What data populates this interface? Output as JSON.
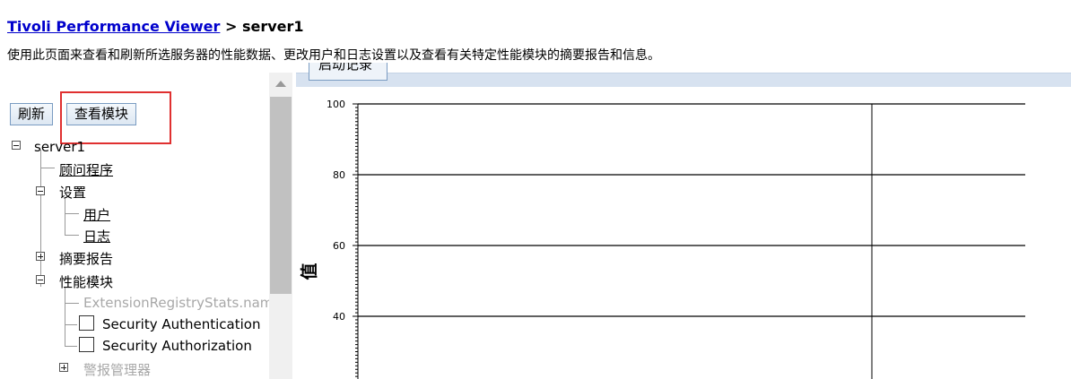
{
  "breadcrumb": {
    "link": "Tivoli Performance Viewer",
    "separator": " > ",
    "current": "server1"
  },
  "description": "使用此页面来查看和刷新所选服务器的性能数据、更改用户和日志设置以及查看有关特定性能模块的摘要报告和信息。",
  "toolbar": {
    "refresh": "刷新",
    "view_modules": "查看模块"
  },
  "tree": {
    "root": "server1",
    "advisor": "顾问程序",
    "settings": "设置",
    "user": "用户",
    "log": "日志",
    "summary_reports": "摘要报告",
    "perf_modules": "性能模块",
    "ext_registry": "ExtensionRegistryStats.name",
    "sec_authn": "Security Authentication",
    "sec_authz": "Security Authorization",
    "alarm_manager": "警报管理器"
  },
  "chart_top_button": "启动记录",
  "chart_data": {
    "type": "line",
    "ylabel": "值",
    "ylim": [
      30,
      100
    ],
    "yticks": [
      100,
      80,
      60,
      40
    ],
    "series": []
  }
}
